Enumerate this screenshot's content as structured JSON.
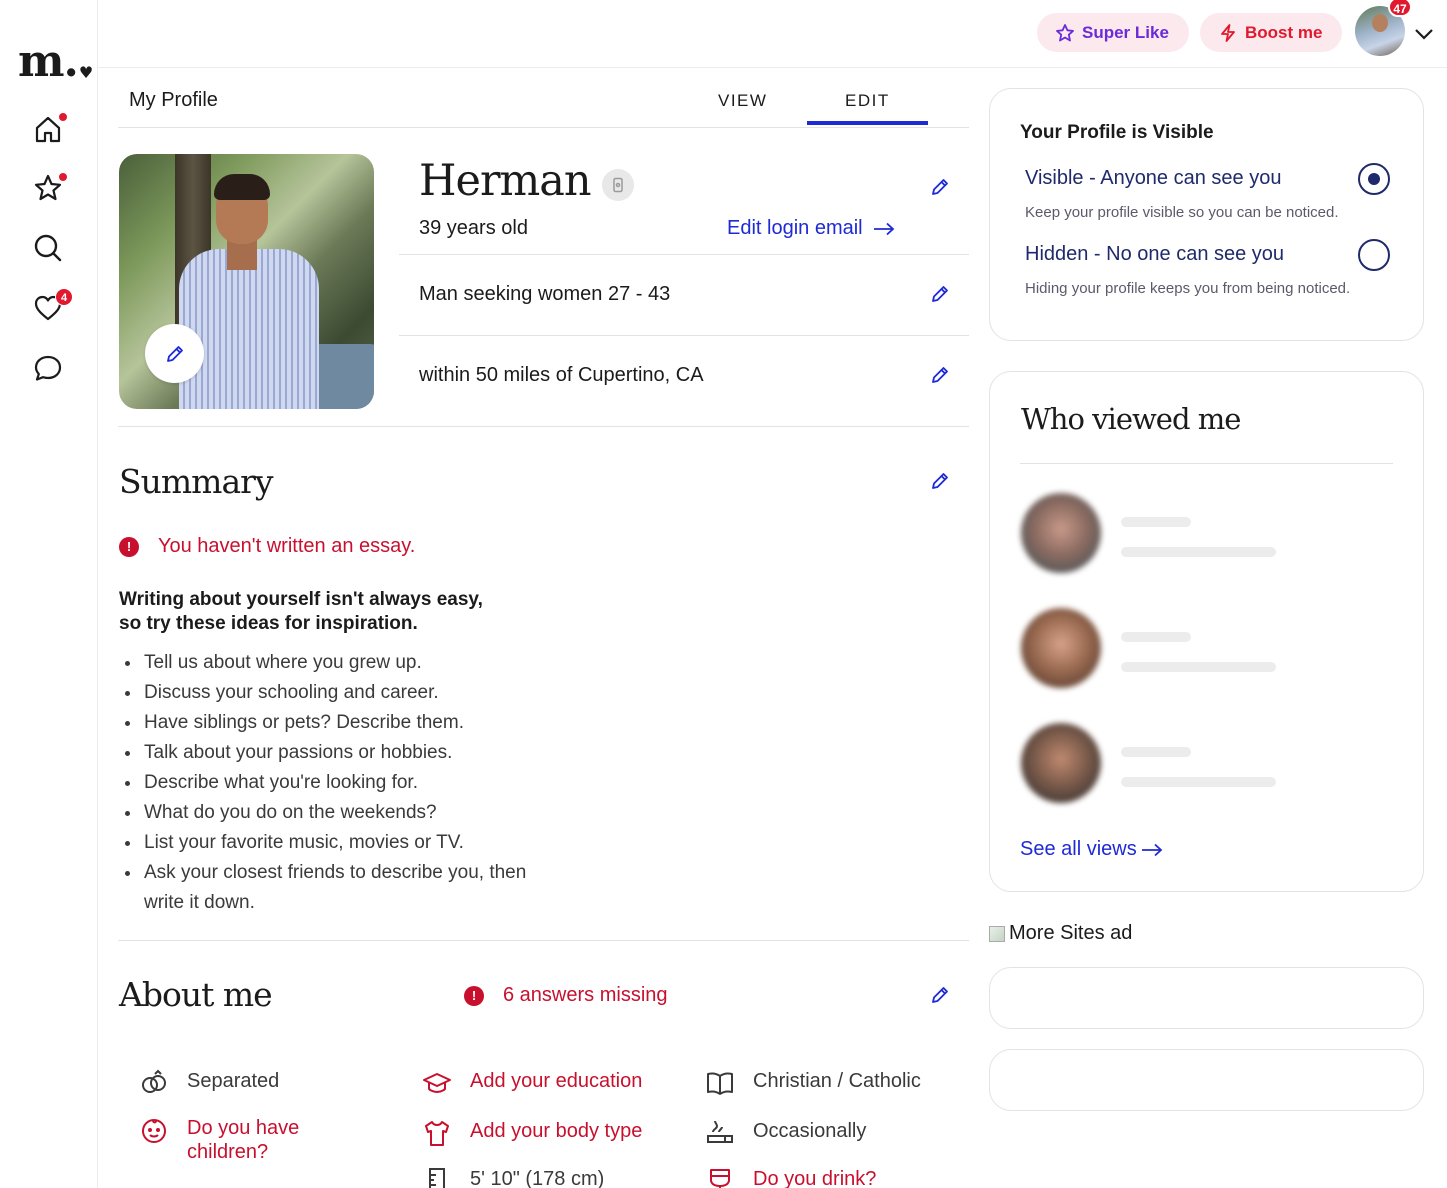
{
  "nav": {
    "logo": "m.",
    "items": [
      {
        "name": "home",
        "has_dot": true
      },
      {
        "name": "super-like",
        "has_dot": true
      },
      {
        "name": "search",
        "has_dot": false
      },
      {
        "name": "likes",
        "badge": "4"
      },
      {
        "name": "messages",
        "has_dot": false
      }
    ]
  },
  "topbar": {
    "super_like_label": "Super Like",
    "boost_label": "Boost me",
    "avatar_badge": "47"
  },
  "profile": {
    "header": "My Profile",
    "tabs": [
      {
        "label": "VIEW",
        "active": false
      },
      {
        "label": "EDIT",
        "active": true
      }
    ],
    "name": "Herman",
    "age": "39 years old",
    "edit_login_email": "Edit login email",
    "seeking": "Man seeking women 27 - 43",
    "location": "within 50 miles of Cupertino, CA"
  },
  "summary": {
    "title": "Summary",
    "warning": "You haven't written an essay.",
    "tips_heading_line1": "Writing about yourself isn't always easy,",
    "tips_heading_line2": "so try these ideas for inspiration.",
    "tips": [
      "Tell us about where you grew up.",
      "Discuss your schooling and career.",
      "Have siblings or pets? Describe them.",
      "Talk about your passions or hobbies.",
      "Describe what you're looking for.",
      "What do you do on the weekends?",
      "List your favorite music, movies or TV.",
      "Ask your closest friends to describe you, then write it down."
    ]
  },
  "about": {
    "title": "About me",
    "missing": "6 answers missing",
    "items": {
      "relationship": "Separated",
      "education": "Add your education",
      "religion": "Christian / Catholic",
      "children": "Do you have children?",
      "body_type": "Add your body type",
      "smoking": "Occasionally",
      "height": "5' 10\" (178 cm)",
      "drinking": "Do you drink?"
    }
  },
  "visibility": {
    "title": "Your Profile is Visible",
    "visible_label": "Visible - Anyone can see you",
    "visible_desc": "Keep your profile visible so you can be noticed.",
    "hidden_label": "Hidden - No one can see you",
    "hidden_desc": "Hiding your profile keeps you from being noticed.",
    "selected": "visible"
  },
  "who_viewed": {
    "title": "Who viewed me",
    "see_all": "See all views"
  },
  "ad": {
    "alt": "More Sites ad"
  },
  "colors": {
    "accent_blue": "#1e2ad6",
    "alert_red": "#c8102e",
    "super_like_purple": "#6b2bd9"
  }
}
